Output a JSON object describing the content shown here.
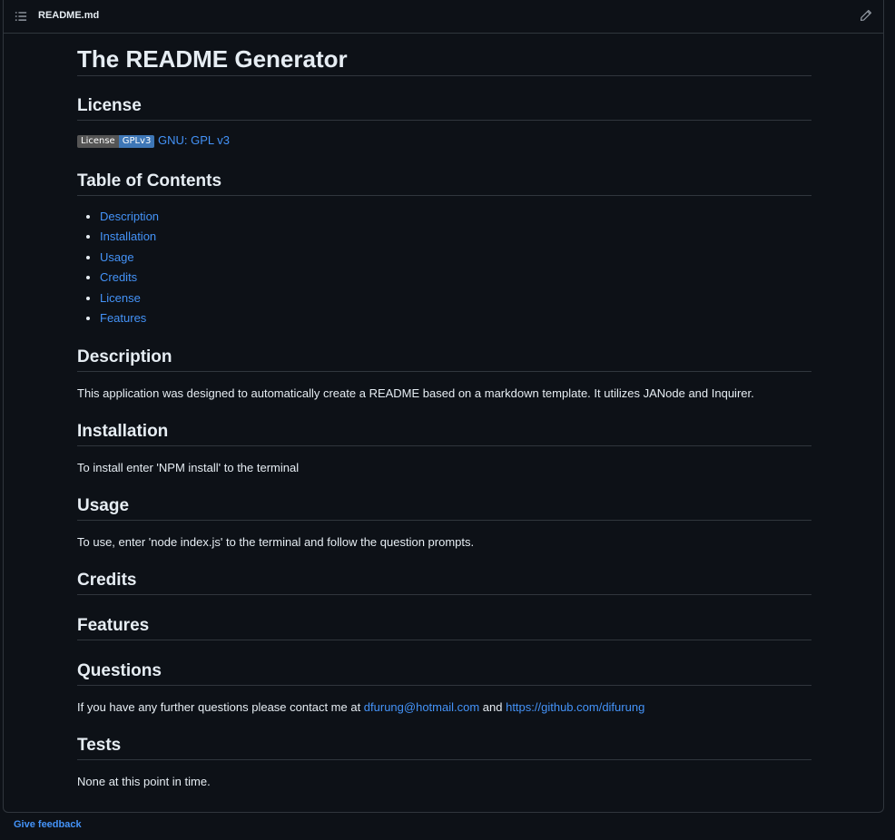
{
  "header": {
    "file_name": "README.md"
  },
  "readme": {
    "title": "The README Generator",
    "license": {
      "heading": "License",
      "badge_left": "License",
      "badge_right": "GPLv3",
      "link": "GNU: GPL v3"
    },
    "toc": {
      "heading": "Table of Contents",
      "items": [
        "Description",
        "Installation",
        "Usage",
        "Credits",
        "License",
        "Features"
      ]
    },
    "description": {
      "heading": "Description",
      "text": "This application was designed to automatically create a README based on a markdown template. It utilizes JANode and Inquirer."
    },
    "installation": {
      "heading": "Installation",
      "text": "To install enter 'NPM install' to the terminal"
    },
    "usage": {
      "heading": "Usage",
      "text": "To use, enter 'node index.js' to the terminal and follow the question prompts."
    },
    "credits": {
      "heading": "Credits"
    },
    "features": {
      "heading": "Features"
    },
    "questions": {
      "heading": "Questions",
      "text_before": "If you have any further questions please contact me at ",
      "email": "dfurung@hotmail.com",
      "text_mid": " and ",
      "github": "https://github.com/difurung"
    },
    "tests": {
      "heading": "Tests",
      "text": "None at this point in time."
    }
  },
  "footer": {
    "feedback": "Give feedback"
  },
  "colors": {
    "background": "#0d1117",
    "border": "#30363d",
    "link": "#4493f8",
    "text": "#e6edf3"
  }
}
